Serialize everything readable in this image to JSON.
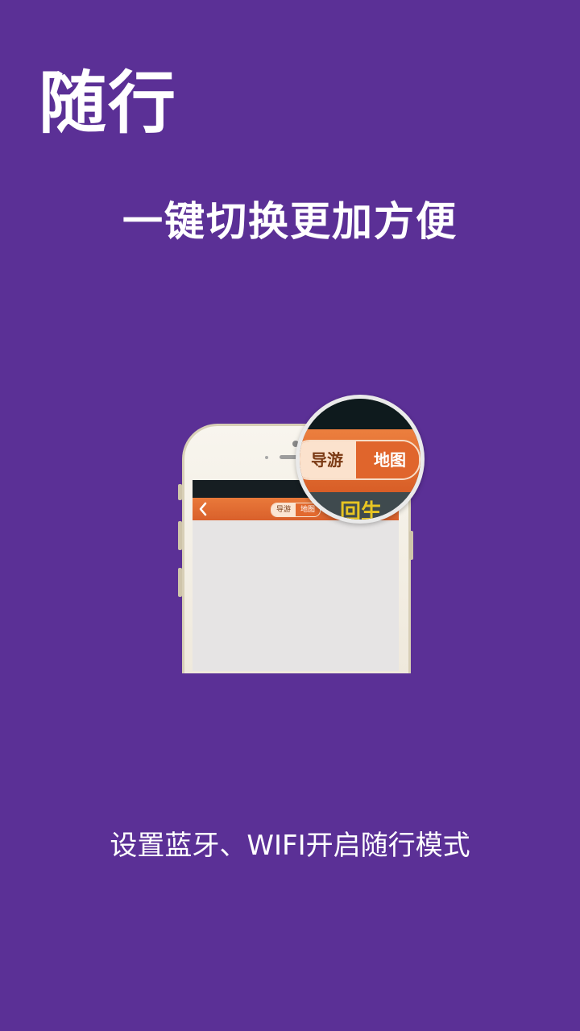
{
  "header": {
    "title": "随行",
    "subtitle": "一键切换更加方便"
  },
  "phone": {
    "toggle": {
      "active_label": "导游",
      "inactive_label": "地图"
    }
  },
  "magnifier": {
    "toggle": {
      "active_label": "导游",
      "inactive_label": "地图"
    },
    "partial_text": "回生"
  },
  "footer": {
    "description": "设置蓝牙、WIFI开启随行模式"
  },
  "colors": {
    "background": "#5b3096",
    "accent_orange": "#e2692e",
    "text_white": "#ffffff"
  },
  "icons": {
    "back": "chevron-left-icon"
  }
}
